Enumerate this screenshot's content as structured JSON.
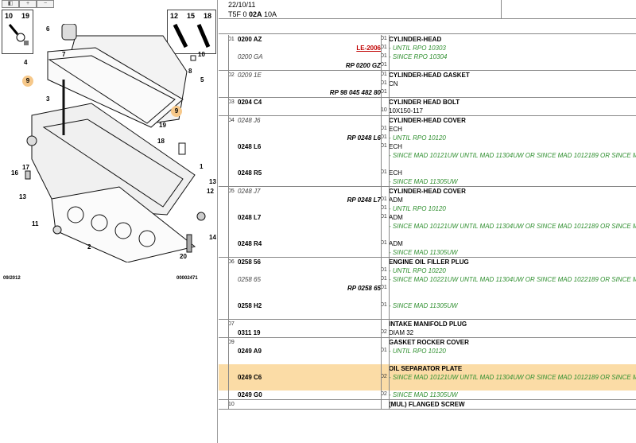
{
  "toolbar": {
    "btn1": "",
    "btn2": "",
    "btn3": ""
  },
  "diagram": {
    "boxes": {
      "left_a": "10",
      "left_b": "19",
      "right_a": "12",
      "right_b": "15",
      "right_c": "18"
    },
    "callouts": [
      "6",
      "4",
      "7",
      "3",
      "9",
      "9",
      "5",
      "10",
      "8",
      "19",
      "18",
      "1",
      "16",
      "17",
      "13",
      "12",
      "11",
      "2",
      "14",
      "20",
      "13",
      "19",
      "4"
    ],
    "footer_left": "09/2012",
    "footer_right": "00002471"
  },
  "header": {
    "date": "22/10/11",
    "ref_prefix": "T5F 0 ",
    "ref_bold": "02A",
    "ref_suffix": " 10A"
  },
  "groups": [
    {
      "num": "01",
      "lines": [
        {
          "code": "0200 AZ",
          "code_italic": false,
          "ref": "",
          "ref_red": false,
          "qty": "01",
          "desc": "CYLINDER-HEAD",
          "style": "title"
        },
        {
          "code": "",
          "ref": "LE-2006",
          "ref_red": true,
          "qty": "01",
          "desc": "- UNTIL RPO 10303",
          "style": "note"
        },
        {
          "code": "0200 GA",
          "code_italic": true,
          "ref": "",
          "qty": "01",
          "desc": "- SINCE RPO 10304",
          "style": "note"
        },
        {
          "code": "",
          "ref": "RP 0200 GZ",
          "qty": "01",
          "desc": "",
          "style": "plain"
        }
      ]
    },
    {
      "num": "02",
      "lines": [
        {
          "code": "0209 1E",
          "code_italic": true,
          "ref": "",
          "qty": "01",
          "desc": "CYLINDER-HEAD GASKET",
          "style": "title"
        },
        {
          "code": "",
          "ref": "",
          "qty": "01",
          "desc": "CN",
          "style": "plain"
        },
        {
          "code": "",
          "ref": "RP 98 045 482 80",
          "qty": "01",
          "desc": "",
          "style": "plain"
        }
      ]
    },
    {
      "num": "03",
      "lines": [
        {
          "code": "0204 C4",
          "code_italic": false,
          "ref": "",
          "qty": "",
          "desc": "CYLINDER HEAD BOLT",
          "style": "title"
        },
        {
          "code": "",
          "ref": "",
          "qty": "10",
          "desc": "10X150-117",
          "style": "plain"
        }
      ]
    },
    {
      "num": "04",
      "lines": [
        {
          "code": "0248 J6",
          "code_italic": true,
          "ref": "",
          "qty": "",
          "desc": "CYLINDER-HEAD COVER",
          "style": "title"
        },
        {
          "code": "",
          "ref": "",
          "qty": "01",
          "desc": "ECH",
          "style": "plain"
        },
        {
          "code": "",
          "ref": "RP 0248 L6",
          "qty": "01",
          "desc": "- UNTIL RPO 10120",
          "style": "note"
        },
        {
          "code": "0248 L6",
          "code_italic": false,
          "ref": "",
          "qty": "01",
          "desc": "ECH",
          "style": "plain"
        },
        {
          "code": "",
          "ref": "",
          "qty": "",
          "desc": "- SINCE MAD 10121UW UNTIL MAD 11304UW OR SINCE MAD 1012189 OR SINCE MAD 1",
          "style": "note"
        },
        {
          "code": "",
          "ref": "",
          "qty": "",
          "desc": "",
          "style": "plain"
        },
        {
          "code": "0248 R5",
          "code_italic": false,
          "ref": "",
          "qty": "01",
          "desc": "ECH",
          "style": "plain"
        },
        {
          "code": "",
          "ref": "",
          "qty": "",
          "desc": "- SINCE MAD 11305UW",
          "style": "note"
        }
      ]
    },
    {
      "num": "05",
      "lines": [
        {
          "code": "0248 J7",
          "code_italic": true,
          "ref": "",
          "qty": "",
          "desc": "CYLINDER-HEAD COVER",
          "style": "title"
        },
        {
          "code": "",
          "ref": "RP 0248 L7",
          "qty": "01",
          "desc": "ADM",
          "style": "plain"
        },
        {
          "code": "",
          "ref": "",
          "qty": "01",
          "desc": "- UNTIL RPO 10120",
          "style": "note"
        },
        {
          "code": "0248 L7",
          "code_italic": false,
          "ref": "",
          "qty": "01",
          "desc": "ADM",
          "style": "plain"
        },
        {
          "code": "",
          "ref": "",
          "qty": "",
          "desc": "- SINCE MAD 10121UW UNTIL MAD 11304UW OR SINCE MAD 1012189 OR SINCE MAD 1",
          "style": "note"
        },
        {
          "code": "",
          "ref": "",
          "qty": "",
          "desc": "",
          "style": "plain"
        },
        {
          "code": "0248 R4",
          "code_italic": false,
          "ref": "",
          "qty": "01",
          "desc": "ADM",
          "style": "plain"
        },
        {
          "code": "",
          "ref": "",
          "qty": "",
          "desc": "- SINCE MAD 11305UW",
          "style": "note"
        }
      ]
    },
    {
      "num": "06",
      "lines": [
        {
          "code": "0258 56",
          "code_italic": false,
          "ref": "",
          "qty": "",
          "desc": "ENGINE OIL FILLER PLUG",
          "style": "title"
        },
        {
          "code": "",
          "ref": "",
          "qty": "01",
          "desc": "- UNTIL RPO 10220",
          "style": "note"
        },
        {
          "code": "0258 65",
          "code_italic": true,
          "ref": "",
          "qty": "01",
          "desc": "- SINCE MAD 10221UW UNTIL MAD 11304UW OR SINCE MAD 1022189 OR SINCE MAD 1",
          "style": "note"
        },
        {
          "code": "",
          "ref": "RP 0258 65",
          "qty": "01",
          "desc": "",
          "style": "plain"
        },
        {
          "code": "",
          "ref": "",
          "qty": "",
          "desc": "",
          "style": "plain"
        },
        {
          "code": "0258 H2",
          "code_italic": false,
          "ref": "",
          "qty": "01",
          "desc": "- SINCE MAD 11305UW",
          "style": "note"
        },
        {
          "code": "",
          "ref": "",
          "qty": "",
          "desc": "",
          "style": "plain"
        }
      ]
    },
    {
      "num": "07",
      "lines": [
        {
          "code": "",
          "ref": "",
          "qty": "",
          "desc": "INTAKE MANIFOLD PLUG",
          "style": "title"
        },
        {
          "code": "0311 19",
          "code_italic": false,
          "ref": "",
          "qty": "02",
          "desc": "DIAM 32",
          "style": "plain"
        }
      ]
    },
    {
      "num": "09",
      "lines": [
        {
          "code": "",
          "ref": "",
          "qty": "",
          "desc": "GASKET ROCKER COVER",
          "style": "title"
        },
        {
          "code": "0249 A9",
          "code_italic": false,
          "ref": "",
          "qty": "01",
          "desc": "- UNTIL RPO 10120",
          "style": "note"
        },
        {
          "code": "",
          "ref": "",
          "qty": "",
          "desc": "",
          "style": "plain"
        },
        {
          "code": "",
          "ref": "",
          "qty": "",
          "desc": "OIL SEPARATOR PLATE",
          "style": "title",
          "hl": true
        },
        {
          "code": "0249 C6",
          "code_italic": false,
          "ref": "",
          "qty": "02",
          "desc": "- SINCE MAD 10121UW UNTIL MAD 11304UW OR SINCE MAD 1012189 OR SINCE MAD 1",
          "style": "note",
          "hl": true
        },
        {
          "code": "",
          "ref": "",
          "qty": "",
          "desc": "",
          "style": "plain",
          "hl": true
        },
        {
          "code": "0249 G0",
          "code_italic": false,
          "ref": "",
          "qty": "02",
          "desc": "- SINCE MAD 11305UW",
          "style": "note"
        }
      ]
    },
    {
      "num": "10",
      "lines": [
        {
          "code": "",
          "ref": "",
          "qty": "",
          "desc": "(MUL) FLANGED SCREW",
          "style": "title"
        }
      ]
    }
  ]
}
